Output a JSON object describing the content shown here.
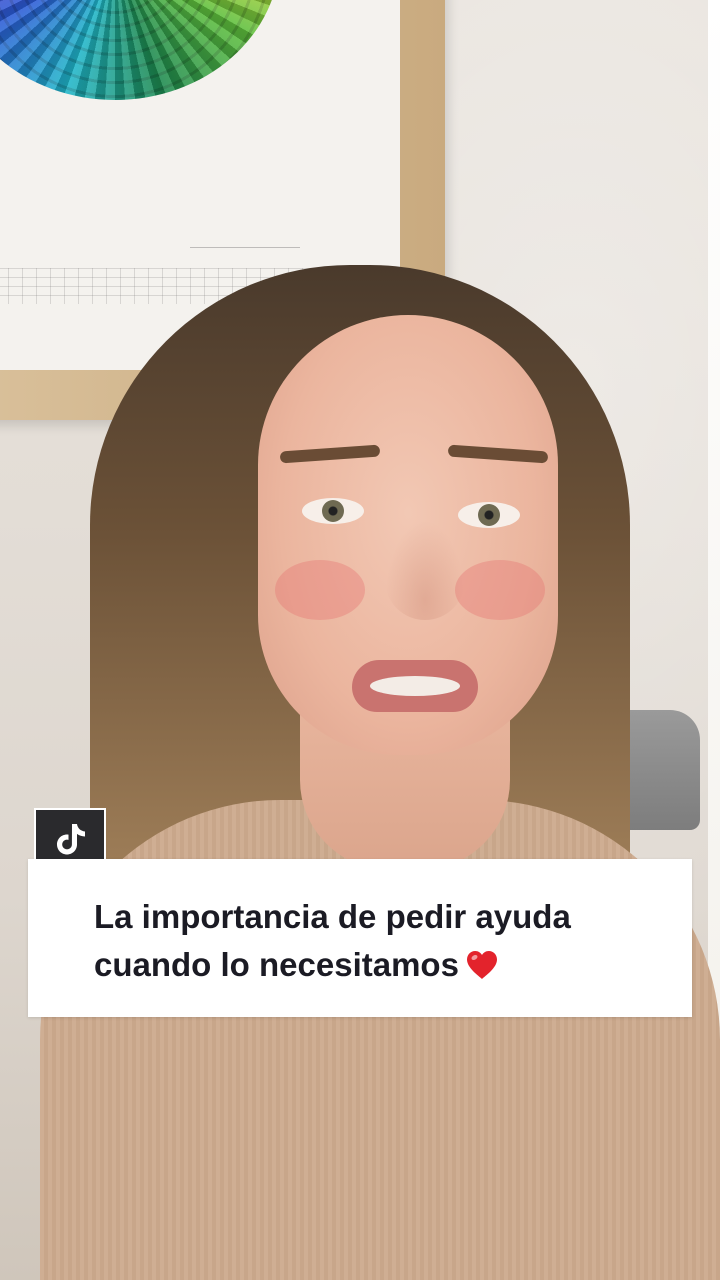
{
  "video": {
    "caption_lines": [
      "La importancia de pedir ayuda",
      "cuando lo necesitamos"
    ],
    "caption_emoji": "heart-icon",
    "accent_color": "#e3232c",
    "caption_text_color": "#1b1b24",
    "caption_bg_color": "#ffffff"
  },
  "app": {
    "logo_icon": "tiktok-logo-icon",
    "logo_bg_color": "#2a2a2d"
  }
}
